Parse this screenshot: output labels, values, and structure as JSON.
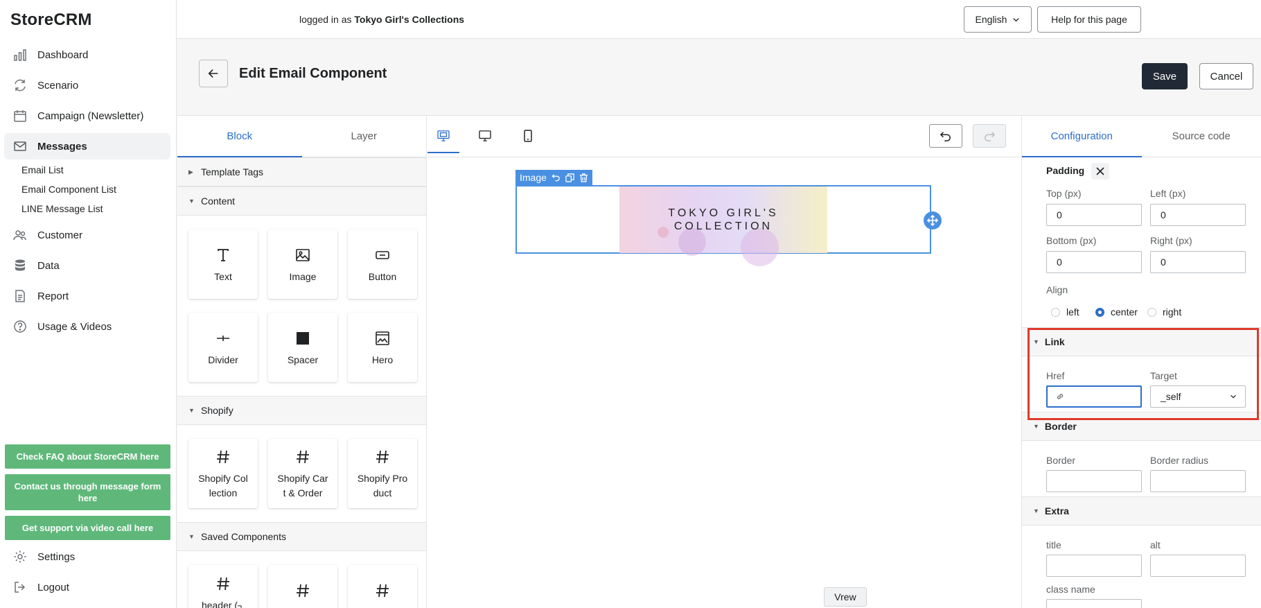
{
  "app": {
    "logo": "StoreCRM"
  },
  "sidebar": {
    "items": [
      {
        "label": "Dashboard",
        "icon": "chart-bar-icon"
      },
      {
        "label": "Scenario",
        "icon": "refresh-icon"
      },
      {
        "label": "Campaign (Newsletter)",
        "icon": "calendar-icon"
      },
      {
        "label": "Messages",
        "icon": "mail-icon",
        "active": true
      },
      {
        "label": "Customer",
        "icon": "users-icon"
      },
      {
        "label": "Data",
        "icon": "database-icon"
      },
      {
        "label": "Report",
        "icon": "report-icon"
      },
      {
        "label": "Usage & Videos",
        "icon": "help-icon"
      }
    ],
    "subitems": [
      "Email List",
      "Email Component List",
      "LINE Message List"
    ],
    "help_buttons": [
      "Check FAQ about StoreCRM here",
      "Contact us through message form here",
      "Get support via video call here"
    ],
    "settings": "Settings",
    "logout": "Logout",
    "accent_green": "#5fb87a"
  },
  "topbar": {
    "login_prefix": "logged in as",
    "store_name": "Tokyo Girl's Collections",
    "language": "English",
    "help": "Help for this page"
  },
  "page": {
    "title": "Edit Email Component",
    "save": "Save",
    "cancel": "Cancel"
  },
  "left_panel": {
    "tabs": [
      "Block",
      "Layer"
    ],
    "sections": {
      "template_tags": "Template Tags",
      "content": "Content",
      "shopify": "Shopify",
      "saved": "Saved Components"
    },
    "content_blocks": [
      "Text",
      "Image",
      "Button",
      "Divider",
      "Spacer",
      "Hero"
    ],
    "shopify_blocks": [
      "Shopify Col lection",
      "Shopify Car t & Order",
      "Shopify Pro duct"
    ],
    "saved_blocks": [
      "header (┐",
      "",
      ""
    ]
  },
  "canvas": {
    "image_label": "Image",
    "banner_line1": "TOKYO GIRL'S",
    "banner_line2": "COLLECTION",
    "vrew": "Vrew"
  },
  "right_panel": {
    "tabs": [
      "Configuration",
      "Source code"
    ],
    "padding": {
      "title": "Padding",
      "top_label": "Top (px)",
      "top_value": "0",
      "left_label": "Left (px)",
      "left_value": "0",
      "bottom_label": "Bottom (px)",
      "bottom_value": "0",
      "right_label": "Right (px)",
      "right_value": "0"
    },
    "align": {
      "label": "Align",
      "options": [
        "left",
        "center",
        "right"
      ],
      "selected": "center"
    },
    "link": {
      "title": "Link",
      "href_label": "Href",
      "href_value": "",
      "target_label": "Target",
      "target_value": "_self"
    },
    "border": {
      "title": "Border",
      "border_label": "Border",
      "radius_label": "Border radius"
    },
    "extra": {
      "title": "Extra",
      "title_label": "title",
      "alt_label": "alt",
      "class_label": "class name"
    }
  },
  "colors": {
    "primary_blue": "#2c6ecb",
    "dark_button": "#202935",
    "highlight_red": "#e0392b"
  }
}
